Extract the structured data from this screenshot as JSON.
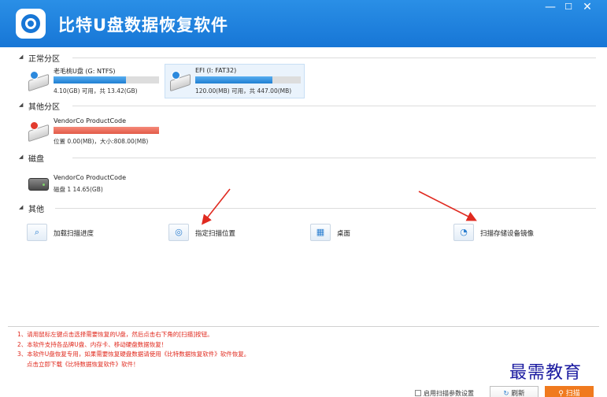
{
  "window": {
    "title": "比特U盘数据恢复软件",
    "minimize_glyph": "—",
    "maximize_glyph": "☐",
    "close_glyph": "✕"
  },
  "sections": {
    "normal": "正常分区",
    "other_partitions": "其他分区",
    "disks": "磁盘",
    "other": "其他"
  },
  "normal_drives": [
    {
      "name": "老毛桃U盘 (G: NTFS)",
      "info": "4.10(GB) 可用，共 13.42(GB)",
      "used_fraction": 0.69
    },
    {
      "name": "EFI (I: FAT32)",
      "info": "120.00(MB) 可用，共 447.00(MB)",
      "used_fraction": 0.73
    }
  ],
  "other_partition": {
    "name": "VendorCo ProductCode",
    "info": "位置 0.00(MB)，大小:808.00(MB)",
    "used_fraction": 1.0
  },
  "disk": {
    "name": "VendorCo ProductCode",
    "info": "磁盘 1    14.65(GB)"
  },
  "tools": [
    {
      "label": "加载扫描进度",
      "icon": "load-progress-icon"
    },
    {
      "label": "指定扫描位置",
      "icon": "target-location-icon"
    },
    {
      "label": "桌面",
      "icon": "desktop-icon"
    },
    {
      "label": "扫描存储设备镜像",
      "icon": "disk-image-icon"
    }
  ],
  "notes": [
    "1、请用鼠标左键点击选择需要恢复的U盘，然后点击右下角的[扫描]按钮。",
    "2、本软件支持各品牌U盘、内存卡、移动硬盘数据恢复！",
    "3、本软件U盘恢复专用，如果需要恢复硬盘数据请使用《比特数据恢复软件》软件恢复。",
    "点击立即下载《比特数据恢复软件》软件！"
  ],
  "footer": {
    "option_label": "启用扫描参数设置",
    "refresh_label": "刷新",
    "scan_label": "扫描"
  },
  "watermark": "最需教育",
  "colors": {
    "titlebar": "#1776d6",
    "accent": "#f07a1e",
    "note_red": "#e0281c"
  }
}
